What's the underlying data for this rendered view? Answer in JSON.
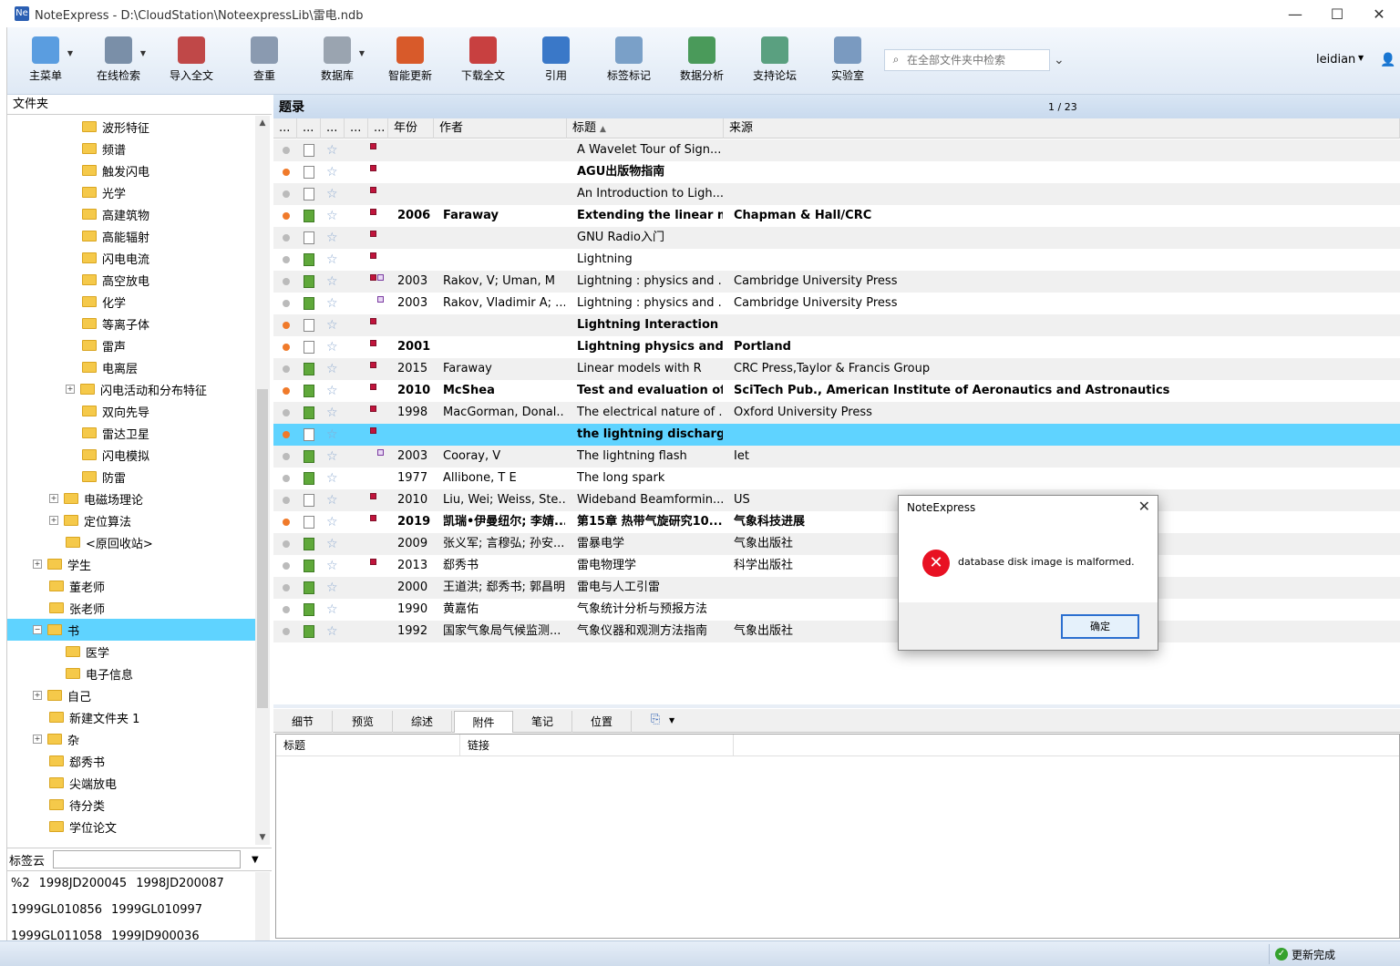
{
  "window": {
    "title": "NoteExpress - D:\\CloudStation\\NoteexpressLib\\雷电.ndb",
    "app_icon": "Ne"
  },
  "toolbar": {
    "buttons": [
      {
        "label": "主菜单",
        "icon": "main-menu-icon",
        "color": "#5a9de0"
      },
      {
        "label": "在线检索",
        "icon": "online-search-icon",
        "color": "#7a8fa8"
      },
      {
        "label": "导入全文",
        "icon": "import-fulltext-icon",
        "color": "#c04848"
      },
      {
        "label": "查重",
        "icon": "find-duplicates-icon",
        "color": "#8a9ab0"
      },
      {
        "label": "数据库",
        "icon": "database-icon",
        "color": "#9aa4b0"
      },
      {
        "label": "智能更新",
        "icon": "smart-update-icon",
        "color": "#d85a2a"
      },
      {
        "label": "下载全文",
        "icon": "download-fulltext-icon",
        "color": "#c84040"
      },
      {
        "label": "引用",
        "icon": "cite-icon",
        "color": "#3a78c8"
      },
      {
        "label": "标签标记",
        "icon": "tag-icon",
        "color": "#7aa0c8"
      },
      {
        "label": "数据分析",
        "icon": "data-analysis-icon",
        "color": "#4a9a5a"
      },
      {
        "label": "支持论坛",
        "icon": "forum-icon",
        "color": "#5aa080"
      },
      {
        "label": "实验室",
        "icon": "lab-icon",
        "color": "#7a9ac0"
      }
    ],
    "search_placeholder": "在全部文件夹中检索",
    "user": "leidian"
  },
  "sidebar": {
    "header": "文件夹",
    "folders": [
      {
        "label": "波形特征",
        "level": 2,
        "expand": ""
      },
      {
        "label": "频谱",
        "level": 2,
        "expand": ""
      },
      {
        "label": "触发闪电",
        "level": 2,
        "expand": ""
      },
      {
        "label": "光学",
        "level": 2,
        "expand": ""
      },
      {
        "label": "高建筑物",
        "level": 2,
        "expand": ""
      },
      {
        "label": "高能辐射",
        "level": 2,
        "expand": ""
      },
      {
        "label": "闪电电流",
        "level": 2,
        "expand": ""
      },
      {
        "label": "高空放电",
        "level": 2,
        "expand": ""
      },
      {
        "label": "化学",
        "level": 2,
        "expand": ""
      },
      {
        "label": "等离子体",
        "level": 2,
        "expand": ""
      },
      {
        "label": "雷声",
        "level": 2,
        "expand": ""
      },
      {
        "label": "电离层",
        "level": 2,
        "expand": ""
      },
      {
        "label": "闪电活动和分布特征",
        "level": 2,
        "expand": "+"
      },
      {
        "label": "双向先导",
        "level": 2,
        "expand": ""
      },
      {
        "label": "雷达卫星",
        "level": 2,
        "expand": ""
      },
      {
        "label": "闪电模拟",
        "level": 2,
        "expand": ""
      },
      {
        "label": "防雷",
        "level": 2,
        "expand": ""
      },
      {
        "label": "电磁场理论",
        "level": 1,
        "expand": "+"
      },
      {
        "label": "定位算法",
        "level": 1,
        "expand": "+"
      },
      {
        "label": "<原回收站>",
        "level": 1,
        "expand": ""
      },
      {
        "label": "学生",
        "level": 0,
        "expand": "+"
      },
      {
        "label": "董老师",
        "level": 0,
        "expand": ""
      },
      {
        "label": "张老师",
        "level": 0,
        "expand": ""
      },
      {
        "label": "书",
        "level": 0,
        "expand": "-",
        "selected": true
      },
      {
        "label": "医学",
        "level": 1,
        "expand": ""
      },
      {
        "label": "电子信息",
        "level": 1,
        "expand": ""
      },
      {
        "label": "自己",
        "level": 0,
        "expand": "+"
      },
      {
        "label": "新建文件夹 1",
        "level": 0,
        "expand": ""
      },
      {
        "label": "杂",
        "level": 0,
        "expand": "+"
      },
      {
        "label": "郄秀书",
        "level": 0,
        "expand": ""
      },
      {
        "label": "尖端放电",
        "level": 0,
        "expand": ""
      },
      {
        "label": "待分类",
        "level": 0,
        "expand": ""
      },
      {
        "label": "学位论文",
        "level": 0,
        "expand": ""
      }
    ],
    "tagcloud_label": "标签云",
    "tags": [
      [
        "%2",
        "1998JD200045",
        "1998JD200087"
      ],
      [
        "1999GL010856",
        "1999GL010997"
      ],
      [
        "1999GL011058",
        "1999JD900036"
      ]
    ]
  },
  "list": {
    "title": "题录",
    "page": "1 / 23",
    "headers": [
      "...",
      "...",
      "...",
      "...",
      "...",
      "年份",
      "作者",
      "标题",
      "来源"
    ],
    "sort_indicator": "▲",
    "rows": [
      {
        "dot": "gray",
        "doc": "plain",
        "flags": [
          "red"
        ],
        "year": "",
        "author": "",
        "title": "A Wavelet Tour of Sign...",
        "source": "",
        "bold": false
      },
      {
        "dot": "orange",
        "doc": "plain",
        "flags": [
          "red"
        ],
        "year": "",
        "author": "",
        "title": "AGU出版物指南",
        "source": "",
        "bold": true
      },
      {
        "dot": "gray",
        "doc": "plain",
        "flags": [
          "red"
        ],
        "year": "",
        "author": "",
        "title": "An Introduction to Ligh...",
        "source": "",
        "bold": false
      },
      {
        "dot": "orange",
        "doc": "green",
        "flags": [
          "red"
        ],
        "year": "2006",
        "author": "Faraway",
        "title": "Extending the linear mo",
        "source": "Chapman & Hall/CRC",
        "bold": true
      },
      {
        "dot": "gray",
        "doc": "plain",
        "flags": [
          "red"
        ],
        "year": "",
        "author": "",
        "title": "GNU Radio入门",
        "source": "",
        "bold": false
      },
      {
        "dot": "gray",
        "doc": "green",
        "flags": [
          "red"
        ],
        "year": "",
        "author": "",
        "title": "Lightning",
        "source": "",
        "bold": false
      },
      {
        "dot": "gray",
        "doc": "green",
        "flags": [
          "red",
          "pur"
        ],
        "year": "2003",
        "author": "Rakov, V; Uman, M",
        "title": "Lightning : physics and ...",
        "source": "Cambridge University Press",
        "bold": false
      },
      {
        "dot": "gray",
        "doc": "green",
        "flags": [
          "none",
          "pur"
        ],
        "year": "2003",
        "author": "Rakov, Vladimir A; ...",
        "title": "Lightning : physics and ...",
        "source": "Cambridge University Press",
        "bold": false
      },
      {
        "dot": "orange",
        "doc": "plain",
        "flags": [
          "red"
        ],
        "year": "",
        "author": "",
        "title": "Lightning Interaction wi",
        "source": "",
        "bold": true
      },
      {
        "dot": "orange",
        "doc": "blank",
        "flags": [
          "red"
        ],
        "year": "2001",
        "author": "",
        "title": "Lightning physics and li.",
        "source": "Portland",
        "bold": true
      },
      {
        "dot": "gray",
        "doc": "green",
        "flags": [
          "red"
        ],
        "year": "2015",
        "author": "Faraway",
        "title": "Linear models with R",
        "source": "CRC Press,Taylor & Francis Group",
        "bold": false
      },
      {
        "dot": "orange",
        "doc": "green",
        "flags": [
          "red"
        ],
        "year": "2010",
        "author": "McShea",
        "title": "Test and evaluation of a",
        "source": "SciTech Pub., American Institute of Aeronautics and Astronautics",
        "bold": true
      },
      {
        "dot": "gray",
        "doc": "green",
        "flags": [
          "red"
        ],
        "year": "1998",
        "author": "MacGorman, Donal...",
        "title": "The electrical nature of ...",
        "source": "Oxford University Press",
        "bold": false
      },
      {
        "dot": "orange",
        "doc": "plain",
        "flags": [
          "red"
        ],
        "year": "",
        "author": "",
        "title": "the lightning discharge",
        "source": "",
        "bold": true,
        "selected": true
      },
      {
        "dot": "gray",
        "doc": "green",
        "flags": [
          "none",
          "pur"
        ],
        "year": "2003",
        "author": "Cooray, V",
        "title": "The lightning flash",
        "source": "Iet",
        "bold": false
      },
      {
        "dot": "gray",
        "doc": "green",
        "flags": [],
        "year": "1977",
        "author": "Allibone, T E",
        "title": "The long spark",
        "source": "",
        "bold": false
      },
      {
        "dot": "gray",
        "doc": "blank",
        "flags": [
          "red"
        ],
        "year": "2010",
        "author": "Liu, Wei; Weiss, Ste...",
        "title": "Wideband Beamformin...",
        "source": "US",
        "bold": false
      },
      {
        "dot": "orange",
        "doc": "plain",
        "flags": [
          "red"
        ],
        "year": "2019",
        "author": "凯瑞•伊曼纽尔; 李婧...",
        "title": "第15章  热带气旋研究10...",
        "source": "气象科技进展",
        "bold": true
      },
      {
        "dot": "gray",
        "doc": "green",
        "flags": [],
        "year": "2009",
        "author": "张义军; 言穆弘; 孙安...",
        "title": "雷暴电学",
        "source": "气象出版社",
        "bold": false
      },
      {
        "dot": "gray",
        "doc": "green",
        "flags": [
          "red"
        ],
        "year": "2013",
        "author": "郄秀书",
        "title": "雷电物理学",
        "source": "科学出版社",
        "bold": false
      },
      {
        "dot": "gray",
        "doc": "green",
        "flags": [],
        "year": "2000",
        "author": "王道洪; 郄秀书; 郭昌明",
        "title": "雷电与人工引雷",
        "source": "",
        "bold": false
      },
      {
        "dot": "gray",
        "doc": "green",
        "flags": [],
        "year": "1990",
        "author": "黄嘉佑",
        "title": "气象统计分析与预报方法",
        "source": "",
        "bold": false
      },
      {
        "dot": "gray",
        "doc": "green",
        "flags": [],
        "year": "1992",
        "author": "国家气象局气候监测...",
        "title": "气象仪器和观测方法指南",
        "source": "气象出版社",
        "bold": false
      }
    ]
  },
  "tabs": {
    "items": [
      "细节",
      "预览",
      "综述",
      "附件",
      "笔记",
      "位置"
    ],
    "active": 3,
    "attach_headers": [
      "标题",
      "链接"
    ]
  },
  "status": {
    "text": "更新完成"
  },
  "dialog": {
    "title": "NoteExpress",
    "message": "database disk image is malformed.",
    "ok": "确定"
  }
}
